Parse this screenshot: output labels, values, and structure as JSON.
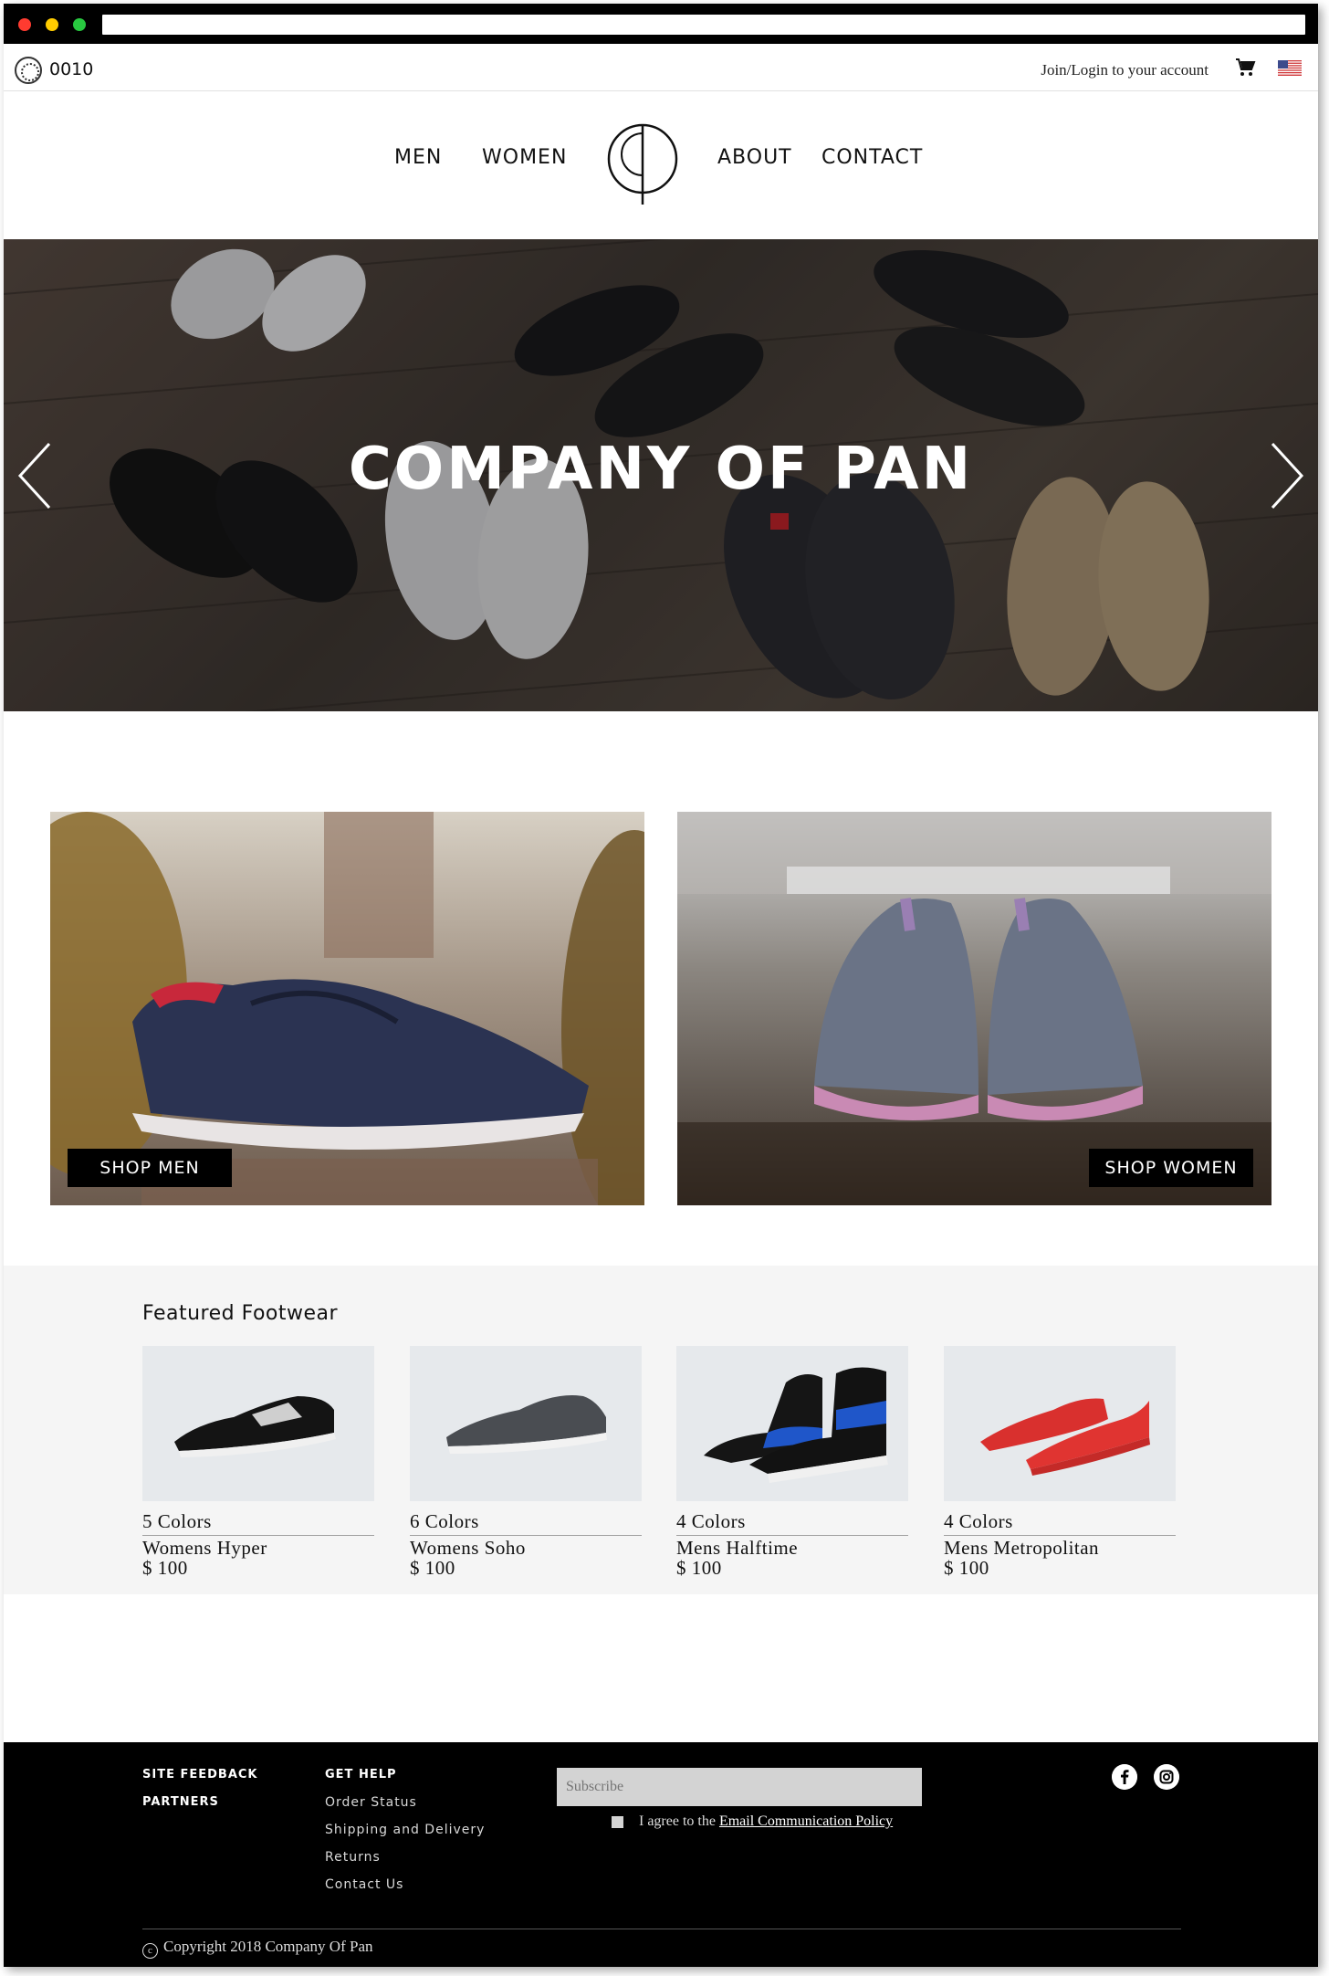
{
  "browser": {
    "url": ""
  },
  "topbar": {
    "brand_code": "0010",
    "account_link": "Join/Login to your account",
    "cart_icon": "cart-icon",
    "flag_icon": "us-flag-icon"
  },
  "nav": {
    "items": [
      {
        "label": "MEN"
      },
      {
        "label": "WOMEN"
      },
      {
        "label": "ABOUT"
      },
      {
        "label": "CONTACT"
      }
    ],
    "logo_icon": "pan-logo-icon"
  },
  "hero": {
    "title": "COMPANY OF PAN",
    "prev_icon": "chevron-left-icon",
    "next_icon": "chevron-right-icon"
  },
  "categories": {
    "men_label": "SHOP MEN",
    "women_label": "SHOP WOMEN"
  },
  "featured": {
    "title": "Featured Footwear",
    "products": [
      {
        "colors": "5 Colors",
        "name": "Womens Hyper",
        "price": "$ 100",
        "shoe_color": "#111111"
      },
      {
        "colors": "6 Colors",
        "name": "Womens Soho",
        "price": "$ 100",
        "shoe_color": "#4a4d52"
      },
      {
        "colors": "4 Colors",
        "name": "Mens Halftime",
        "price": "$ 100",
        "shoe_color": "#1f56c9"
      },
      {
        "colors": "4 Colors",
        "name": "Mens Metropolitan",
        "price": "$ 100",
        "shoe_color": "#d9302e"
      }
    ]
  },
  "footer": {
    "col1": [
      "SITE FEEDBACK",
      "PARTNERS"
    ],
    "col2_title": "GET HELP",
    "col2": [
      "Order Status",
      "Shipping and Delivery",
      "Returns",
      "Contact Us"
    ],
    "subscribe_placeholder": "Subscribe",
    "agree_text": "I agree to the ",
    "agree_link": "Email Communication Policy",
    "social": [
      "facebook-icon",
      "instagram-icon"
    ],
    "copyright": "Copyright 2018 Company Of Pan"
  }
}
